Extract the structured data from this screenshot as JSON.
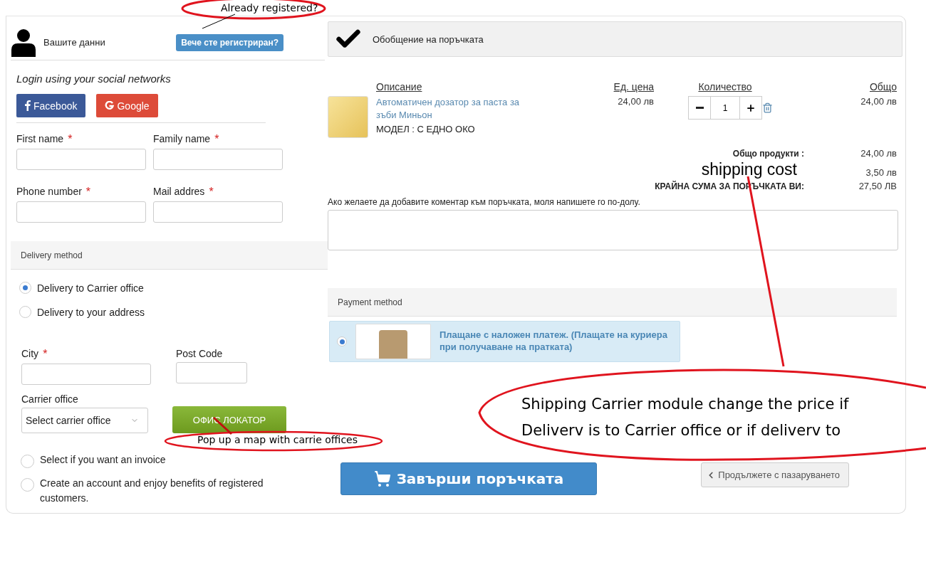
{
  "customer": {
    "title": "Вашите данни",
    "login_button": "Вече сте регистриран?"
  },
  "social": {
    "title": "Login using your social networks",
    "buttons": [
      {
        "kind": "facebook",
        "label": "Facebook"
      },
      {
        "kind": "google",
        "label": "Google"
      }
    ]
  },
  "fields": [
    {
      "label": "First name",
      "marker": "*"
    },
    {
      "label": "Family name",
      "marker": "*"
    },
    {
      "label": "Phone number",
      "marker": "*"
    },
    {
      "label": "Mail addres",
      "marker": "*"
    }
  ],
  "delivery": {
    "title": "Delivery method",
    "options": [
      {
        "label": "Delivery to Carrier office",
        "selected": true
      },
      {
        "label": "Delivery to your address",
        "selected": false
      }
    ],
    "fields": [
      {
        "label": "City",
        "marker": "*"
      },
      {
        "label": "Post Code"
      }
    ],
    "carrier_label": "Carrier office",
    "carrier_select": "Select carrier office",
    "locator_button": "ОФИС ЛОКАТОР"
  },
  "options": [
    {
      "label": "Select if you want an invoice",
      "checked": false
    },
    {
      "label": "Create an account and enjoy benefits of registered customers.",
      "checked": false
    }
  ],
  "summary": {
    "title": "Обобщение на поръчката",
    "columns": [
      "Описание",
      "Ед. цена",
      "Количество",
      "Общо"
    ],
    "items": [
      {
        "name": "Автоматичен дозатор за паста за зъби Миньон",
        "model": "МОДЕЛ : С ЕДНО ОКО",
        "price": "24,00 лв",
        "quantity": "1",
        "total": "24,00 лв"
      }
    ],
    "totals": [
      {
        "kind": "plain",
        "label": "Общо продукти :",
        "value": "24,00 лв"
      },
      {
        "kind": "note",
        "label": "shipping cost",
        "value": "3,50 лв"
      },
      {
        "kind": "grand",
        "label": "КРАЙНА СУМА ЗА ПОРЪЧКАТА ВИ:",
        "value": "27,50 ЛВ"
      }
    ],
    "comment_label": "Ако желаете да добавите коментар към поръчката, моля напишете го по-долу."
  },
  "payment": {
    "title": "Payment method",
    "options": [
      {
        "title": "Плащане с наложен платеж.",
        "note": "(Плащате на куриера при получаване на пратката)",
        "selected": true
      }
    ]
  },
  "actions": {
    "checkout": "Завърши поръчката",
    "continue": "Продължете с пазаруването"
  },
  "annotations": [
    {
      "text": "Already registered?"
    },
    {
      "text": "Pop up a map with carrie offices"
    },
    {
      "text": "Shipping Carrier module change the price if Deliverv is to Carrier office or if deliverv to"
    }
  ]
}
